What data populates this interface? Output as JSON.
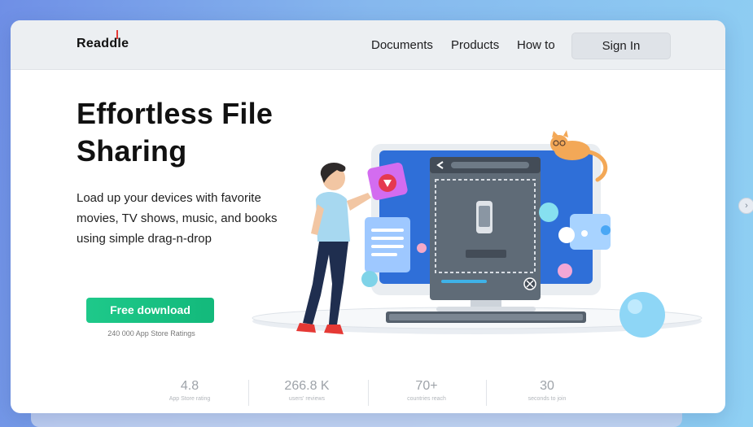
{
  "brand": {
    "logo_text": "Readdle"
  },
  "nav": {
    "links": [
      "Documents",
      "Products",
      "How to"
    ],
    "signin_label": "Sign In"
  },
  "hero": {
    "title": "Effortless File Sharing",
    "subtitle": "Load up your devices with favorite movies, TV shows, music, and books using simple drag-n-drop",
    "cta_label": "Free download",
    "ratings_note": "240 000 App Store Ratings"
  },
  "stats": [
    {
      "value": "4.8",
      "label": "App Store rating"
    },
    {
      "value": "266.8 K",
      "label": "users' reviews"
    },
    {
      "value": "70+",
      "label": "countries reach"
    },
    {
      "value": "30",
      "label": "seconds to join"
    }
  ],
  "colors": {
    "accent_green": "#1ec98a",
    "logo_red": "#e53935",
    "monitor_blue": "#2f6fd8"
  },
  "side_control": {
    "icon": "chevron-right-icon",
    "glyph": "›"
  }
}
